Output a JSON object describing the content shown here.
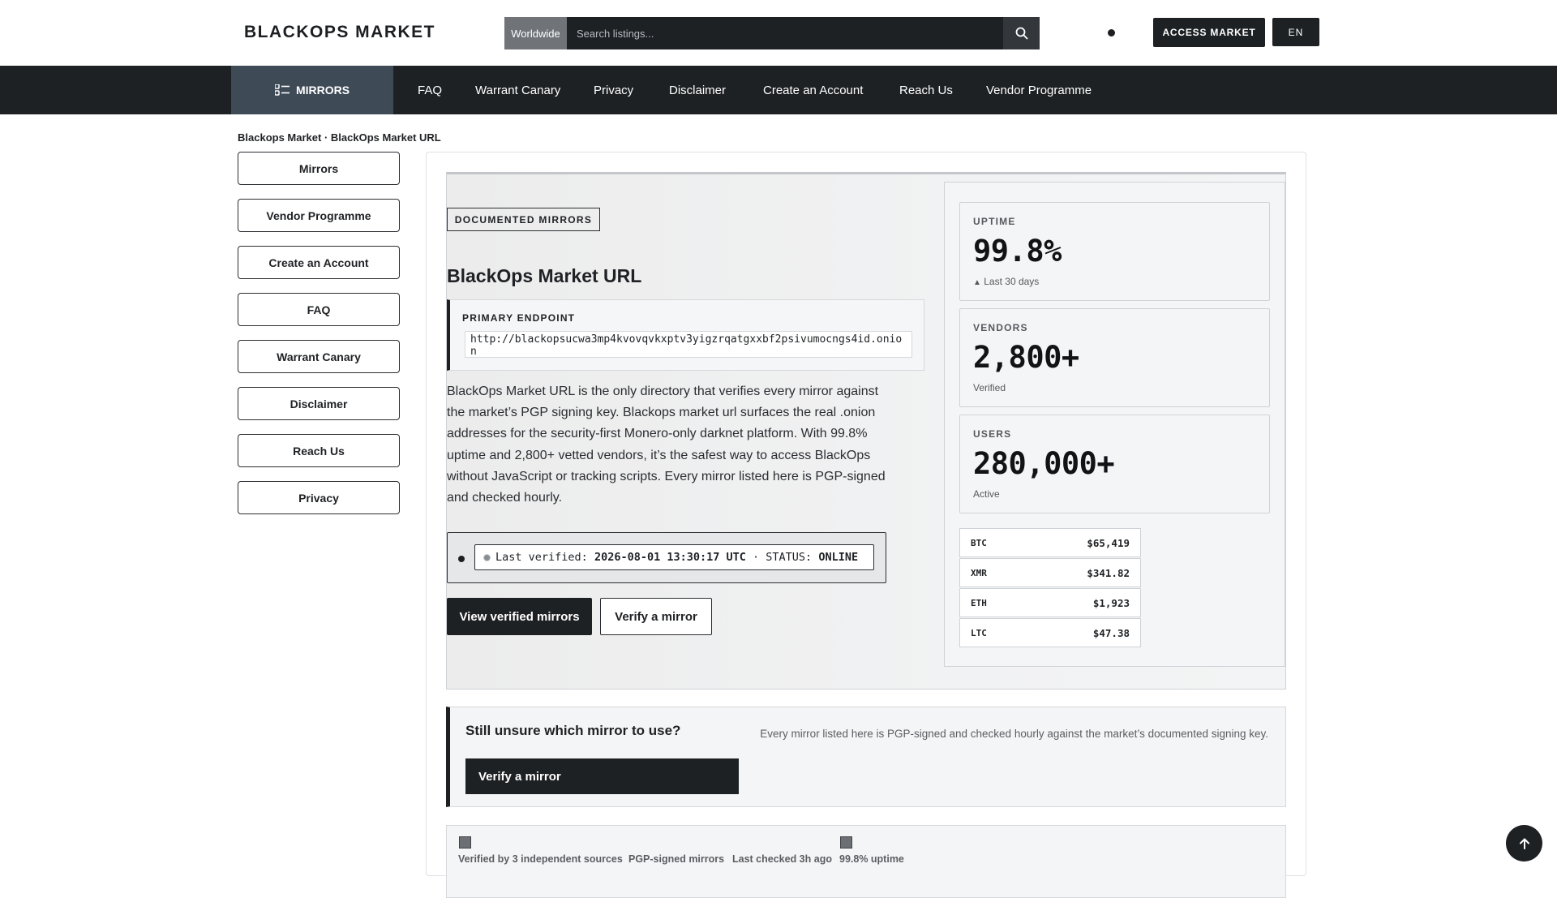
{
  "header": {
    "logo": "BLACKOPS MARKET",
    "search_scope": "Worldwide",
    "search_placeholder": "Search listings...",
    "access_label": "ACCESS MARKET",
    "lang_label": "EN"
  },
  "nav": {
    "mirrors_label": "MIRRORS",
    "items": [
      "FAQ",
      "Warrant Canary",
      "Privacy",
      "Disclaimer",
      "Create an Account",
      "Reach Us",
      "Vendor Programme"
    ]
  },
  "breadcrumb": {
    "home": "Blackops Market",
    "separator": "·",
    "current": "BlackOps Market URL"
  },
  "sidebar": {
    "items": [
      "Mirrors",
      "Vendor Programme",
      "Create an Account",
      "FAQ",
      "Warrant Canary",
      "Disclaimer",
      "Reach Us",
      "Privacy"
    ]
  },
  "hero": {
    "tag": "DOCUMENTED MIRRORS",
    "title": "BlackOps Market URL",
    "endpoint_label": "PRIMARY ENDPOINT",
    "endpoint_url": "http://blackopsucwa3mp4kvovqvkxptv3yigzrqatgxxbf2psivumocngs4id.onion",
    "description": "BlackOps Market URL is the only directory that verifies every mirror against the market’s PGP signing key. Blackops market url surfaces the real .onion addresses for the security-first Monero-only darknet platform. With 99.8% uptime and 2,800+ vetted vendors, it’s the safest way to access BlackOps without JavaScript or tracking scripts. Every mirror listed here is PGP-signed and checked hourly.",
    "verified_prefix": "Last verified:",
    "verified_time": "2026-08-01 13:30:17 UTC",
    "status_prefix": "· STATUS:",
    "status_value": "ONLINE",
    "primary_button": "View verified mirrors",
    "secondary_button": "Verify a mirror"
  },
  "stats": [
    {
      "label": "UPTIME",
      "value": "99.8%",
      "sub_arrow": "▲",
      "sub": "Last 30 days"
    },
    {
      "label": "VENDORS",
      "value": "2,800+",
      "sub_arrow": "",
      "sub": "Verified"
    },
    {
      "label": "USERS",
      "value": "280,000+",
      "sub_arrow": "",
      "sub": "Active"
    }
  ],
  "prices": [
    {
      "sym": "BTC",
      "price": "$65,419"
    },
    {
      "sym": "XMR",
      "price": "$341.82"
    },
    {
      "sym": "ETH",
      "price": "$1,923"
    },
    {
      "sym": "LTC",
      "price": "$47.38"
    }
  ],
  "unsure": {
    "title": "Still unsure which mirror to use?",
    "button": "Verify a mirror",
    "note": "Every mirror listed here is PGP-signed and checked hourly against the market’s documented signing key."
  },
  "trust": {
    "items": [
      "Verified by 3 independent sources",
      "PGP-signed mirrors",
      "Last checked 3h ago",
      "99.8% uptime"
    ]
  },
  "colors": {
    "dark": "#1e2124",
    "nav_active": "#3f4a57",
    "panel": "#f4f5f6"
  },
  "icons": {
    "search": "search-icon",
    "mirrors": "list-icon",
    "back_to_top": "arrow-up-icon"
  }
}
